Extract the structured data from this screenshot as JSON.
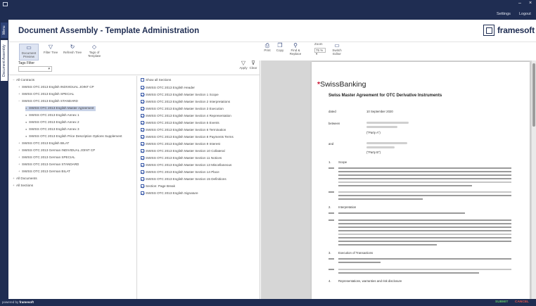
{
  "topbar": {
    "minimize": "–",
    "close": "×",
    "settings_label": "Settings",
    "logout_label": "Logout"
  },
  "vtabs": [
    "Menu",
    "Document Assembly"
  ],
  "header": {
    "title": "Document Assembly - Template Administration",
    "logo_text": "framesoft"
  },
  "left_toolbar": {
    "buttons": [
      {
        "label": "Document Preview",
        "icon": "document-preview-icon"
      },
      {
        "label": "Filter Tree",
        "icon": "filter-icon"
      },
      {
        "label": "Refresh Tree",
        "icon": "refresh-icon"
      },
      {
        "label": "Tags of Template",
        "icon": "tag-icon"
      }
    ],
    "tag_filter_label": "Tags Filter",
    "apply_label": "Apply",
    "clear_label": "Clear"
  },
  "tree": [
    {
      "label": "All Contracts",
      "level": 0,
      "toggle": "−"
    },
    {
      "label": "SWISS OTC 2013 English INDIVIDUAL JOINT CP",
      "level": 1,
      "toggle": "+"
    },
    {
      "label": "SWISS OTC 2013 English SPECIAL",
      "level": 1,
      "toggle": "+"
    },
    {
      "label": "SWISS OTC 2013 English STANDARD",
      "level": 1,
      "toggle": "−"
    },
    {
      "label": "SWISS OTC 2013 English Master Agreement",
      "level": 2,
      "selected": true
    },
    {
      "label": "SWISS OTC 2013 English Annex 1",
      "level": 2
    },
    {
      "label": "SWISS OTC 2013 English Annex 2",
      "level": 2
    },
    {
      "label": "SWISS OTC 2013 English Annex 3",
      "level": 2
    },
    {
      "label": "SWISS OTC 2013 English Price Description Options Supplement",
      "level": 2
    },
    {
      "label": "SWISS OTC 2013 English BILAT",
      "level": 1,
      "toggle": "+"
    },
    {
      "label": "SWISS OTC 2013 German INDIVIDUAL JOINT CP",
      "level": 1,
      "toggle": "+"
    },
    {
      "label": "SWISS OTC 2013 German SPECIAL",
      "level": 1,
      "toggle": "+"
    },
    {
      "label": "SWISS OTC 2013 German STANDARD",
      "level": 1,
      "toggle": "+"
    },
    {
      "label": "SWISS OTC 2013 German BILAT",
      "level": 1,
      "toggle": "+"
    },
    {
      "label": "All Documents",
      "level": 0,
      "toggle": "+"
    },
    {
      "label": "All Sections",
      "level": 0,
      "toggle": "+"
    }
  ],
  "sections": {
    "show_all_label": "Show all Sections",
    "items": [
      {
        "label": "SWISS OTC 2013 English Header",
        "checked": true
      },
      {
        "label": "SWISS OTC 2013 English Master Section 1 Scope",
        "checked": true
      },
      {
        "label": "SWISS OTC 2013 English Master Section 2 Interpretations",
        "checked": true
      },
      {
        "label": "SWISS OTC 2013 English Master Section 3 Execution",
        "checked": true
      },
      {
        "label": "SWISS OTC 2013 English Master Section 4 Representation",
        "checked": true
      },
      {
        "label": "SWISS OTC 2013 English Master Section 5 Events",
        "checked": true
      },
      {
        "label": "SWISS OTC 2013 English Master Section 6 Termination",
        "checked": true
      },
      {
        "label": "SWISS OTC 2013 English Master Section 8 Payments Terms",
        "checked": true
      },
      {
        "label": "SWISS OTC 2013 English Master Section 9 Interest",
        "checked": true
      },
      {
        "label": "SWISS OTC 2013 English Master Section 10 Collateral",
        "checked": true
      },
      {
        "label": "SWISS OTC 2013 English Master Section 11 Notices",
        "checked": true
      },
      {
        "label": "SWISS OTC 2013 English Master Section 13 Miscellaneous",
        "checked": true
      },
      {
        "label": "SWISS OTC 2013 English Master Section 14 Place",
        "checked": true
      },
      {
        "label": "SWISS OTC 2013 English Master Section 15 Definitions",
        "checked": true
      },
      {
        "label": "Section: Page Break",
        "checked": true
      },
      {
        "label": "SWISS OTC 2013 English Signature",
        "checked": true
      }
    ]
  },
  "right_toolbar": {
    "buttons": [
      {
        "label": "Print",
        "icon": "print-icon"
      },
      {
        "label": "Copy",
        "icon": "copy-icon"
      },
      {
        "label": "Find & Replace",
        "icon": "binoculars-icon"
      }
    ],
    "zoom_label": "Zoom",
    "zoom_value": "75 %",
    "switch_label": "Switch Editor",
    "switch_icon": "editor-icon"
  },
  "document": {
    "brand": "SwissBanking",
    "title": "Swiss Master Agreement for OTC Derivative Instruments",
    "dated_label": "dated",
    "dated_value": "10 September 2020",
    "between_label": "between",
    "party_a": "(\"Party A\")",
    "and_label": "and",
    "party_b": "(\"Party B\")",
    "sections": [
      {
        "num": "1.",
        "title": "Scope"
      },
      {
        "num": "2.",
        "title": "Interpretation"
      },
      {
        "num": "3.",
        "title": "Execution of Transactions"
      },
      {
        "num": "4.",
        "title": "Representations, warranties and risk disclosure"
      }
    ]
  },
  "footer": {
    "powered_by": "powered by",
    "brand": "framesoft",
    "submit_label": "SUBMIT",
    "cancel_label": "CANCEL"
  },
  "colors": {
    "navy": "#1f2d52",
    "submit": "#5fc36a",
    "cancel": "#e0584f",
    "brand_red": "#c8102e"
  }
}
